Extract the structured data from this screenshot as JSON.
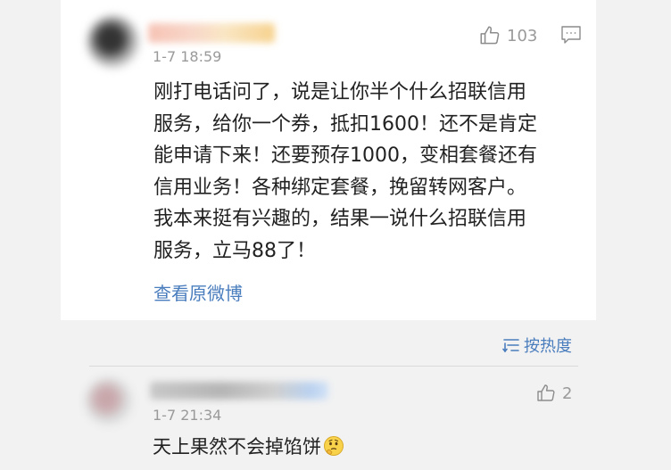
{
  "post": {
    "time": "1-7 18:59",
    "like_count": "103",
    "lines": [
      "刚打电话问了，说是让你半个什么招联信用",
      "服务，给你一个券，抵扣1600！还不是肯定",
      "能申请下来！还要预存1000，变相套餐还有",
      "信用业务！各种绑定套餐，挽留转网客户。",
      "我本来挺有兴趣的，结果一说什么招联信用",
      "服务，立马88了！"
    ],
    "view_original": "查看原微博"
  },
  "sort": {
    "label": "按热度"
  },
  "reply": {
    "time": "1-7 21:34",
    "like_count": "2",
    "text": "天上果然不会掉馅饼",
    "emoji": "thinking-emoji"
  },
  "colors": {
    "link": "#4a7dbd",
    "muted": "#9a9a9a",
    "text": "#222222",
    "background": "#f2f2f2"
  }
}
